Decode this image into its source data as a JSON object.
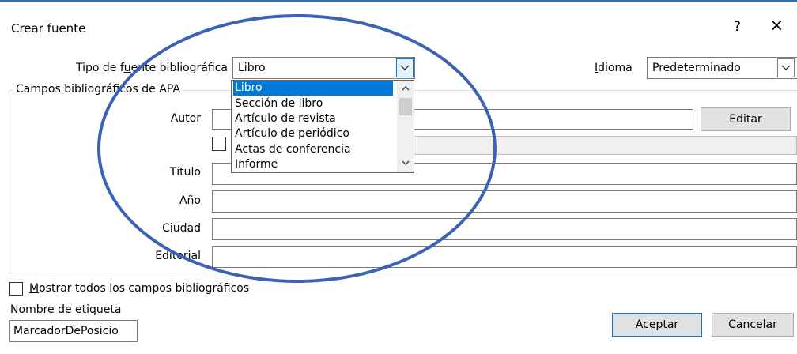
{
  "dialog": {
    "title": "Crear fuente",
    "help_label": "?",
    "close_label": "×"
  },
  "source_type": {
    "label_pre": "Tipo de f",
    "label_u": "u",
    "label_post": "ente bibliográfica",
    "value": "Libro",
    "options": [
      "Libro",
      "Sección de libro",
      "Artículo de revista",
      "Artículo de periódico",
      "Actas de conferencia",
      "Informe"
    ],
    "selected_index": 0
  },
  "language": {
    "label_pre": "",
    "label_u": "I",
    "label_post": "dioma",
    "value": "Predeterminado"
  },
  "group_title": "Campos bibliográficos de APA",
  "fields": {
    "autor": "Autor",
    "titulo": "Título",
    "anio": "Año",
    "ciudad": "Ciudad",
    "editorial": "Editorial"
  },
  "buttons": {
    "editar": "Editar",
    "aceptar": "Aceptar",
    "cancelar": "Cancelar"
  },
  "show_all": {
    "label_u": "M",
    "label_post": "ostrar todos los campos bibliográficos"
  },
  "tag": {
    "label_pre": "N",
    "label_u": "o",
    "label_post": "mbre de etiqueta",
    "value": "MarcadorDePosicio"
  },
  "colors": {
    "accent": "#0078d7",
    "annotation": "#3b62b5"
  }
}
